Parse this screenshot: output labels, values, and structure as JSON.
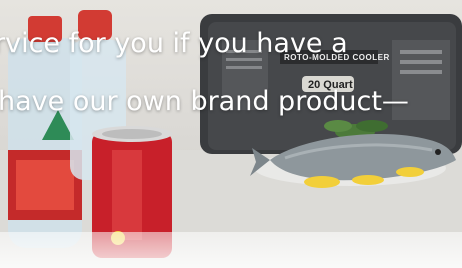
{
  "caption": {
    "line1": "rvice for you if you have a",
    "line2": "have our own brand product—"
  },
  "cooler": {
    "title": "ROTO-MOLDED COOLER",
    "capacity": "20 Quart"
  },
  "colors": {
    "can_red": "#c8202a",
    "fish_body": "#8e979c",
    "lemon": "#f2cf3a",
    "cooler_body": "#3a3c3f"
  }
}
